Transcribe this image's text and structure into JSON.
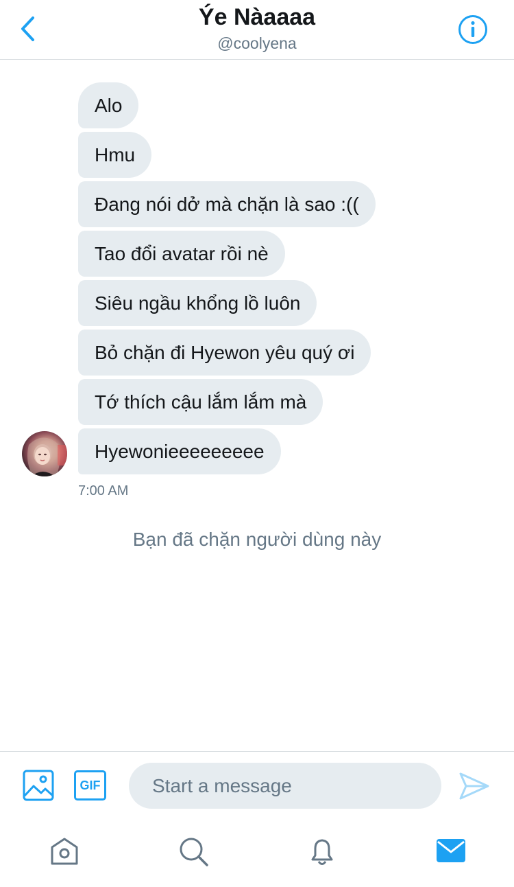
{
  "header": {
    "title": "Ýe Nàaaaa",
    "handle": "@coolyena"
  },
  "messages": [
    {
      "text": "Alo"
    },
    {
      "text": "Hmu"
    },
    {
      "text": "Đang nói dở mà chặn là sao :(("
    },
    {
      "text": "Tao đổi avatar rồi nè"
    },
    {
      "text": "Siêu ngầu khổng lồ luôn"
    },
    {
      "text": "Bỏ chặn đi Hyewon yêu quý ơi"
    },
    {
      "text": "Tớ thích cậu lắm lắm mà"
    },
    {
      "text": "Hyewonieeeeeeeee"
    }
  ],
  "timestamp": "7:00 AM",
  "blocked_note": "Bạn đã chặn người dùng này",
  "composer": {
    "gif_label": "GIF",
    "placeholder": "Start a message"
  },
  "icons": {
    "back": "chevron-left-icon",
    "info": "info-icon",
    "image": "image-icon",
    "send": "send-icon",
    "home": "home-icon",
    "search": "search-icon",
    "notifications": "bell-icon",
    "messages": "envelope-icon"
  },
  "colors": {
    "accent": "#1da1f2",
    "bubble": "#e6ecf0",
    "secondary_text": "#657786"
  }
}
